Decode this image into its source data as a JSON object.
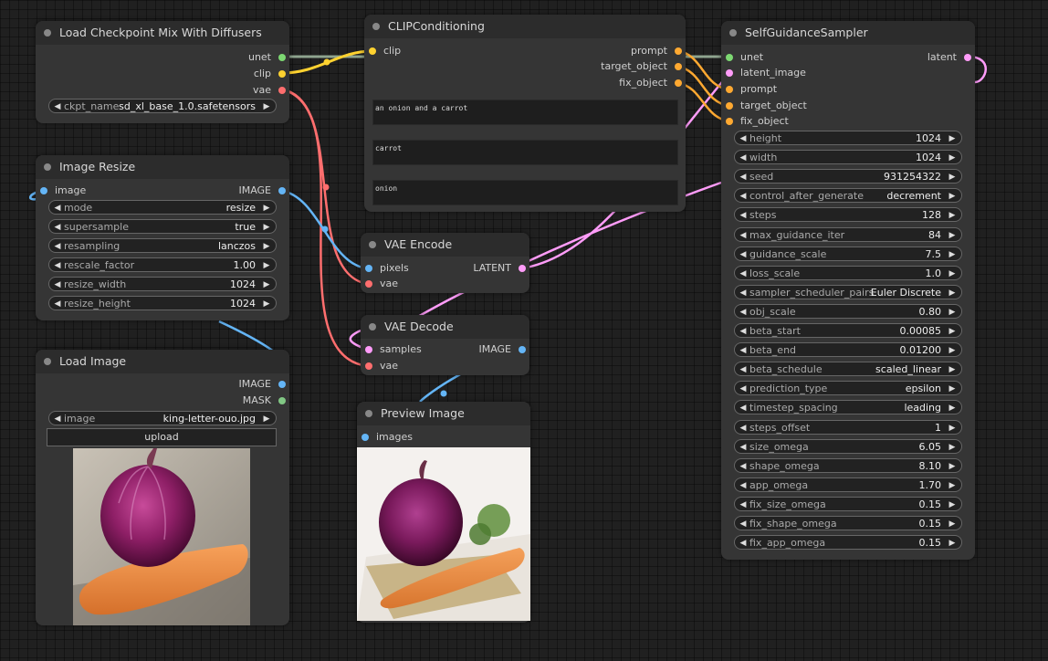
{
  "colors": {
    "model": "#7dd872",
    "clip": "#ffd230",
    "vae": "#ff6e6e",
    "image": "#64b5f6",
    "latent": "#ff9cf9",
    "conditioning": "#ffa931",
    "mask": "#81c784"
  },
  "nodes": {
    "load_checkpoint": {
      "title": "Load Checkpoint Mix With Diffusers",
      "outputs": [
        "unet",
        "clip",
        "vae"
      ],
      "widgets": [
        {
          "label": "ckpt_name",
          "value": "sd_xl_base_1.0.safetensors"
        }
      ]
    },
    "clip_conditioning": {
      "title": "CLIPConditioning",
      "inputs": [
        "clip"
      ],
      "outputs": [
        "prompt",
        "target_object",
        "fix_object"
      ],
      "texts": [
        "an onion and a carrot",
        "carrot",
        "onion"
      ]
    },
    "sampler": {
      "title": "SelfGuidanceSampler",
      "inputs": [
        "unet",
        "latent_image",
        "prompt",
        "target_object",
        "fix_object"
      ],
      "outputs": [
        "latent"
      ],
      "widgets": [
        {
          "label": "height",
          "value": "1024"
        },
        {
          "label": "width",
          "value": "1024"
        },
        {
          "label": "seed",
          "value": "931254322"
        },
        {
          "label": "control_after_generate",
          "value": "decrement"
        },
        {
          "label": "steps",
          "value": "128"
        },
        {
          "label": "max_guidance_iter",
          "value": "84"
        },
        {
          "label": "guidance_scale",
          "value": "7.5"
        },
        {
          "label": "loss_scale",
          "value": "1.0"
        },
        {
          "label": "sampler_scheduler_pairs",
          "value": "Euler Discrete"
        },
        {
          "label": "obj_scale",
          "value": "0.80"
        },
        {
          "label": "beta_start",
          "value": "0.00085"
        },
        {
          "label": "beta_end",
          "value": "0.01200"
        },
        {
          "label": "beta_schedule",
          "value": "scaled_linear"
        },
        {
          "label": "prediction_type",
          "value": "epsilon"
        },
        {
          "label": "timestep_spacing",
          "value": "leading"
        },
        {
          "label": "steps_offset",
          "value": "1"
        },
        {
          "label": "size_omega",
          "value": "6.05"
        },
        {
          "label": "shape_omega",
          "value": "8.10"
        },
        {
          "label": "app_omega",
          "value": "1.70"
        },
        {
          "label": "fix_size_omega",
          "value": "0.15"
        },
        {
          "label": "fix_shape_omega",
          "value": "0.15"
        },
        {
          "label": "fix_app_omega",
          "value": "0.15"
        }
      ]
    },
    "image_resize": {
      "title": "Image Resize",
      "inputs": [
        "image"
      ],
      "outputs": [
        "IMAGE"
      ],
      "widgets": [
        {
          "label": "mode",
          "value": "resize"
        },
        {
          "label": "supersample",
          "value": "true"
        },
        {
          "label": "resampling",
          "value": "lanczos"
        },
        {
          "label": "rescale_factor",
          "value": "1.00"
        },
        {
          "label": "resize_width",
          "value": "1024"
        },
        {
          "label": "resize_height",
          "value": "1024"
        }
      ]
    },
    "vae_encode": {
      "title": "VAE Encode",
      "inputs": [
        "pixels",
        "vae"
      ],
      "outputs": [
        "LATENT"
      ]
    },
    "vae_decode": {
      "title": "VAE Decode",
      "inputs": [
        "samples",
        "vae"
      ],
      "outputs": [
        "IMAGE"
      ]
    },
    "load_image": {
      "title": "Load Image",
      "outputs": [
        "IMAGE",
        "MASK"
      ],
      "widgets": [
        {
          "label": "image",
          "value": "king-letter-ouo.jpg"
        }
      ],
      "button": "upload"
    },
    "preview_image": {
      "title": "Preview Image",
      "inputs": [
        "images"
      ]
    }
  }
}
